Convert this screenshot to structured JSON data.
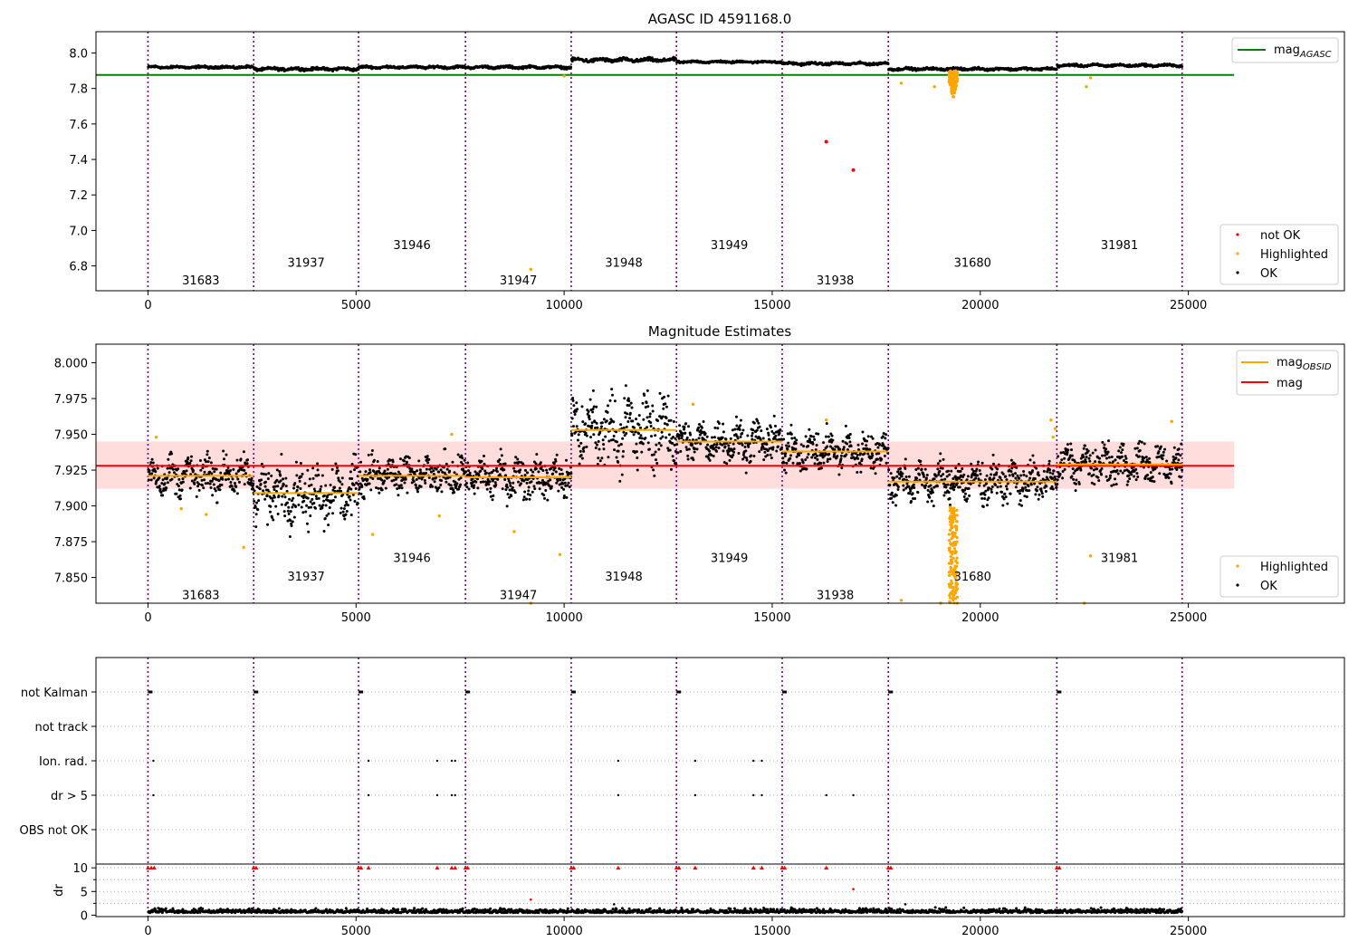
{
  "chart_data": [
    {
      "type": "scatter",
      "title": "AGASC ID 4591168.0",
      "xlim": [
        -1250,
        28750
      ],
      "ylim": [
        6.66,
        8.12
      ],
      "xticks": [
        0,
        5000,
        10000,
        15000,
        20000,
        25000
      ],
      "yticks": [
        6.8,
        7.0,
        7.2,
        7.4,
        7.6,
        7.8,
        8.0
      ],
      "ytick_labels": [
        "6.8",
        "7.0",
        "7.2",
        "7.4",
        "7.6",
        "7.8",
        "8.0"
      ],
      "mag_agasc": 7.876,
      "mag_agasc_xrange": [
        -1250,
        26100
      ],
      "obsids": [
        {
          "label": "31683",
          "x_start": 0,
          "x_end": 2540,
          "mean_ok": 7.92,
          "noise": 0.006
        },
        {
          "label": "31937",
          "x_start": 2540,
          "x_end": 5060,
          "mean_ok": 7.91,
          "noise": 0.007
        },
        {
          "label": "31946",
          "x_start": 5060,
          "x_end": 7630,
          "mean_ok": 7.92,
          "noise": 0.006
        },
        {
          "label": "31947",
          "x_start": 7630,
          "x_end": 10170,
          "mean_ok": 7.92,
          "noise": 0.006
        },
        {
          "label": "31948",
          "x_start": 10170,
          "x_end": 12700,
          "mean_ok": 7.96,
          "noise": 0.009
        },
        {
          "label": "31949",
          "x_start": 12700,
          "x_end": 15240,
          "mean_ok": 7.95,
          "noise": 0.005
        },
        {
          "label": "31938",
          "x_start": 15240,
          "x_end": 17790,
          "mean_ok": 7.94,
          "noise": 0.006
        },
        {
          "label": "31680",
          "x_start": 17790,
          "x_end": 21840,
          "mean_ok": 7.91,
          "noise": 0.006
        },
        {
          "label": "31981",
          "x_start": 21840,
          "x_end": 24850,
          "mean_ok": 7.93,
          "noise": 0.006
        }
      ],
      "obsid_label_y": [
        6.72,
        6.82,
        6.92,
        6.72,
        6.82,
        6.92,
        6.72,
        6.82,
        6.92
      ],
      "not_ok_points": [
        {
          "x": 16300,
          "y": 7.5
        },
        {
          "x": 16950,
          "y": 7.34
        }
      ],
      "highlighted_points": [
        {
          "x": 9200,
          "y": 6.78
        },
        {
          "x": 18100,
          "y": 7.83
        },
        {
          "x": 18900,
          "y": 7.81
        },
        {
          "x": 22550,
          "y": 7.81
        },
        {
          "x": 22650,
          "y": 7.86
        },
        {
          "x": 10000,
          "y": 7.87
        }
      ],
      "highlighted_dip": {
        "x_from": 19250,
        "x_to": 19450,
        "y_min": 7.74
      },
      "legend_top": [
        "mag_AGASC"
      ],
      "legend_bottom": [
        "not OK",
        "Highlighted",
        "OK"
      ]
    },
    {
      "type": "scatter",
      "title": "Magnitude Estimates",
      "xlim": [
        -1250,
        28750
      ],
      "ylim": [
        7.832,
        8.013
      ],
      "xticks": [
        0,
        5000,
        10000,
        15000,
        20000,
        25000
      ],
      "yticks": [
        7.85,
        7.875,
        7.9,
        7.925,
        7.95,
        7.975,
        8.0
      ],
      "ytick_labels": [
        "7.850",
        "7.875",
        "7.900",
        "7.925",
        "7.950",
        "7.975",
        "8.000"
      ],
      "mag": 7.928,
      "mag_band": [
        7.912,
        7.945
      ],
      "mag_xrange": [
        -1250,
        26100
      ],
      "obsid_mags": [
        7.921,
        7.909,
        7.921,
        7.92,
        7.953,
        7.945,
        7.938,
        7.917,
        7.929
      ],
      "obsid_label_y": [
        7.838,
        7.851,
        7.864,
        7.838,
        7.851,
        7.864,
        7.838,
        7.851,
        7.864
      ],
      "highlighted_points": [
        {
          "x": 200,
          "y": 7.948
        },
        {
          "x": 800,
          "y": 7.898
        },
        {
          "x": 1400,
          "y": 7.894
        },
        {
          "x": 2300,
          "y": 7.871
        },
        {
          "x": 5400,
          "y": 7.88
        },
        {
          "x": 7000,
          "y": 7.893
        },
        {
          "x": 8800,
          "y": 7.882
        },
        {
          "x": 9200,
          "y": 7.832
        },
        {
          "x": 9900,
          "y": 7.866
        },
        {
          "x": 18100,
          "y": 7.834
        },
        {
          "x": 19050,
          "y": 7.832
        },
        {
          "x": 22500,
          "y": 7.832
        },
        {
          "x": 22650,
          "y": 7.865
        },
        {
          "x": 13100,
          "y": 7.971
        },
        {
          "x": 16300,
          "y": 7.96
        },
        {
          "x": 24600,
          "y": 7.959
        },
        {
          "x": 7300,
          "y": 7.95
        },
        {
          "x": 21700,
          "y": 7.96
        },
        {
          "x": 21800,
          "y": 7.954
        },
        {
          "x": 21750,
          "y": 7.948
        }
      ],
      "highlighted_dip": {
        "x_from": 19250,
        "x_to": 19450,
        "y_min": 7.832
      },
      "legend_top": [
        "mag_OBSID",
        "mag"
      ],
      "legend_bottom": [
        "Highlighted",
        "OK"
      ]
    },
    {
      "type": "scatter",
      "title": "",
      "xlim": [
        -1250,
        28750
      ],
      "flag_rows": [
        "not Kalman",
        "not track",
        "Ion. rad.",
        "dr > 5",
        "OBS not OK"
      ],
      "not_kalman_x": [
        0,
        2540,
        5060,
        7630,
        10170,
        12700,
        15240,
        17790,
        21840
      ],
      "ion_rad_x": [
        130,
        5300,
        6950,
        7300,
        7380,
        11300,
        13150,
        14550,
        14750
      ],
      "dr_gt5_x": [
        130,
        5300,
        6950,
        7300,
        7380,
        11300,
        13150,
        14550,
        14750,
        16300,
        16950
      ],
      "dr_ylim": [
        0,
        10.5
      ],
      "dr_yticks": [
        0,
        5,
        10
      ],
      "dr_ylabel": "dr",
      "dr_clip_x": [
        0,
        80,
        150,
        2540,
        2600,
        5060,
        5120,
        5300,
        6950,
        7300,
        7380,
        7630,
        7680,
        10170,
        10230,
        11300,
        12700,
        12760,
        13150,
        14550,
        14750,
        15240,
        15300,
        16300,
        17790,
        17850,
        21840,
        21900
      ],
      "dr_mid_points": [
        {
          "x": 9200,
          "y": 3.3
        },
        {
          "x": 16950,
          "y": 5.5
        },
        {
          "x": 11200,
          "y": 2.3
        },
        {
          "x": 18200,
          "y": 2.3
        }
      ]
    }
  ],
  "colors": {
    "ok": "#000000",
    "highlighted": "#ffa500",
    "not_ok": "#ff0000",
    "mag_agasc": "#008000",
    "mag": "#ff0000",
    "mag_obsid": "#ffa500",
    "obsid_divider": "#800080",
    "band": "#ffdddd"
  }
}
